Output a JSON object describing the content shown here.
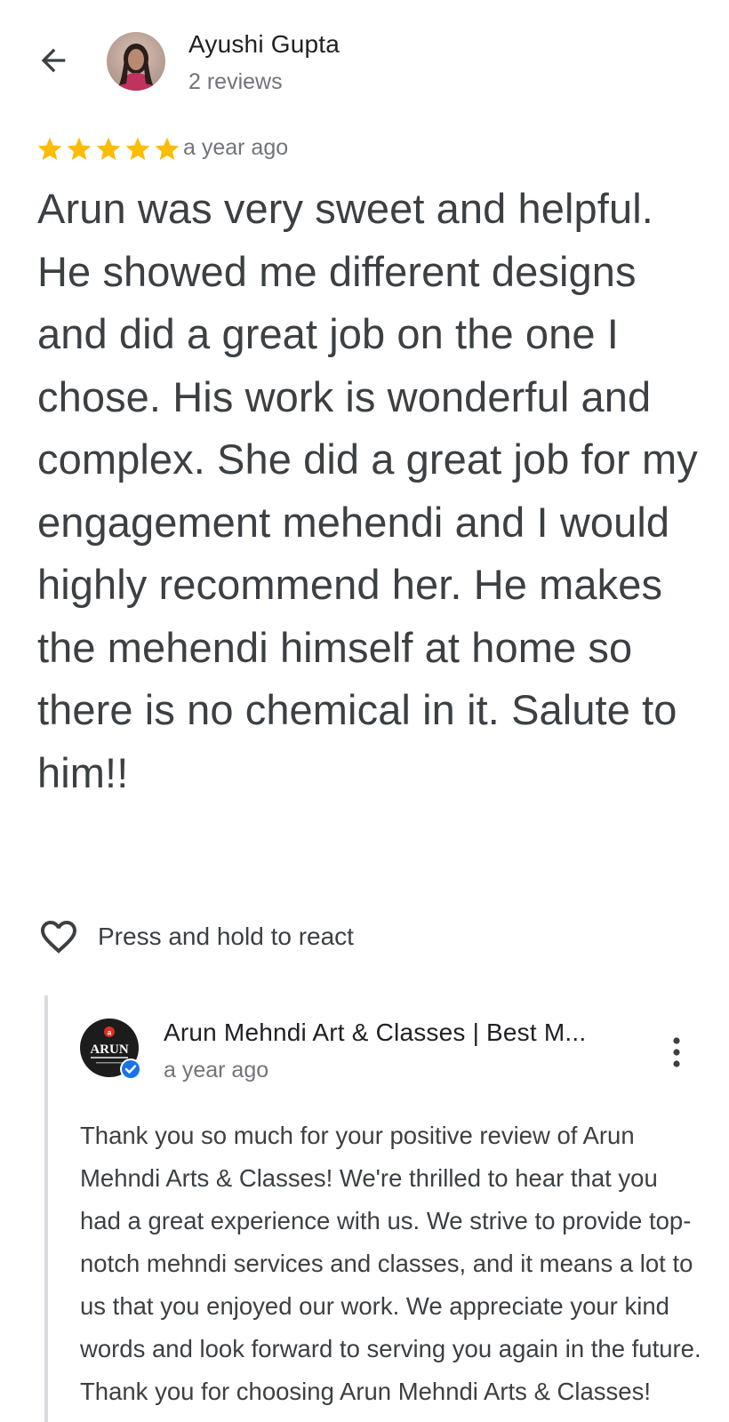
{
  "reviewer": {
    "name": "Ayushi Gupta",
    "review_count": "2 reviews"
  },
  "review": {
    "rating": 5,
    "max_rating": 5,
    "date": "a year ago",
    "text": "Arun was very sweet and helpful. He showed me different designs and did a great job on the one I chose. His work is wonderful and complex. She did a great job for my engagement mehendi and I would highly recommend her. He makes the mehendi himself at home so there is no chemical in it. Salute to him!!"
  },
  "react": {
    "label": "Press and hold to react"
  },
  "owner_reply": {
    "name": "Arun Mehndi Art & Classes | Best M...",
    "date": "a year ago",
    "logo_text": "ARUN",
    "text": "Thank you so much for your positive review of Arun Mehndi Arts & Classes! We're thrilled to hear that you had a great experience with us. We strive to provide top-notch mehndi services and classes, and it means a lot to us that you enjoyed our work. We appreciate your kind words and look forward to serving you again in the future. Thank you for choosing Arun Mehndi Arts & Classes!"
  },
  "colors": {
    "star": "#fbbc04",
    "verified": "#1a73e8",
    "text_primary": "#202124",
    "text_secondary": "#70757a",
    "divider": "#dadce0"
  },
  "icons": {
    "back": "arrow-back-icon",
    "star": "star-icon",
    "react": "heart-outline-icon",
    "verified": "verified-badge-icon",
    "more": "more-vert-icon"
  }
}
